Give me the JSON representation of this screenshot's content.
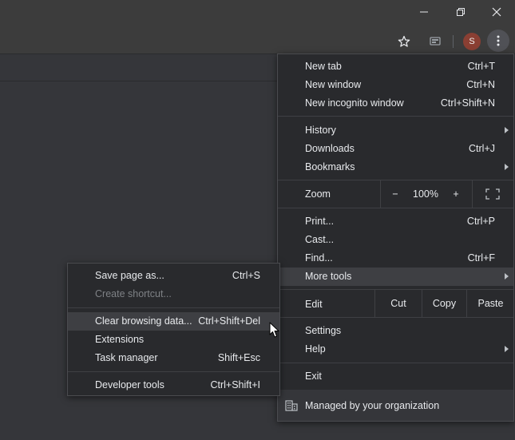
{
  "window_controls": {
    "minimize_icon": "minimize-icon",
    "restore_icon": "restore-icon",
    "close_icon": "close-icon"
  },
  "toolbar": {
    "bookmark_icon": "star-icon",
    "extension_icon": "cast-icon",
    "avatar_letter": "S",
    "menu_icon": "three-dots-vertical-icon"
  },
  "main_menu": {
    "items": [
      {
        "label": "New tab",
        "shortcut": "Ctrl+T"
      },
      {
        "label": "New window",
        "shortcut": "Ctrl+N"
      },
      {
        "label": "New incognito window",
        "shortcut": "Ctrl+Shift+N"
      },
      {
        "label": "History",
        "shortcut": ""
      },
      {
        "label": "Downloads",
        "shortcut": "Ctrl+J"
      },
      {
        "label": "Bookmarks",
        "shortcut": ""
      }
    ],
    "zoom": {
      "label": "Zoom",
      "minus": "−",
      "value": "100%",
      "plus": "+"
    },
    "items2": [
      {
        "label": "Print...",
        "shortcut": "Ctrl+P"
      },
      {
        "label": "Cast...",
        "shortcut": ""
      },
      {
        "label": "Find...",
        "shortcut": "Ctrl+F"
      },
      {
        "label": "More tools",
        "shortcut": ""
      }
    ],
    "edit": {
      "label": "Edit",
      "cut": "Cut",
      "copy": "Copy",
      "paste": "Paste"
    },
    "settings": "Settings",
    "help": "Help",
    "exit": "Exit",
    "managed": "Managed by your organization"
  },
  "submenu": {
    "items": [
      {
        "label": "Save page as...",
        "shortcut": "Ctrl+S"
      },
      {
        "label": "Create shortcut...",
        "shortcut": ""
      },
      {
        "label": "Clear browsing data...",
        "shortcut": "Ctrl+Shift+Del"
      },
      {
        "label": "Extensions",
        "shortcut": ""
      },
      {
        "label": "Task manager",
        "shortcut": "Shift+Esc"
      },
      {
        "label": "Developer tools",
        "shortcut": "Ctrl+Shift+I"
      }
    ]
  },
  "colors": {
    "menu_bg": "#292a2d",
    "highlight": "#3e3f43",
    "text": "#e8eaed",
    "disabled_text": "#7e8185"
  }
}
